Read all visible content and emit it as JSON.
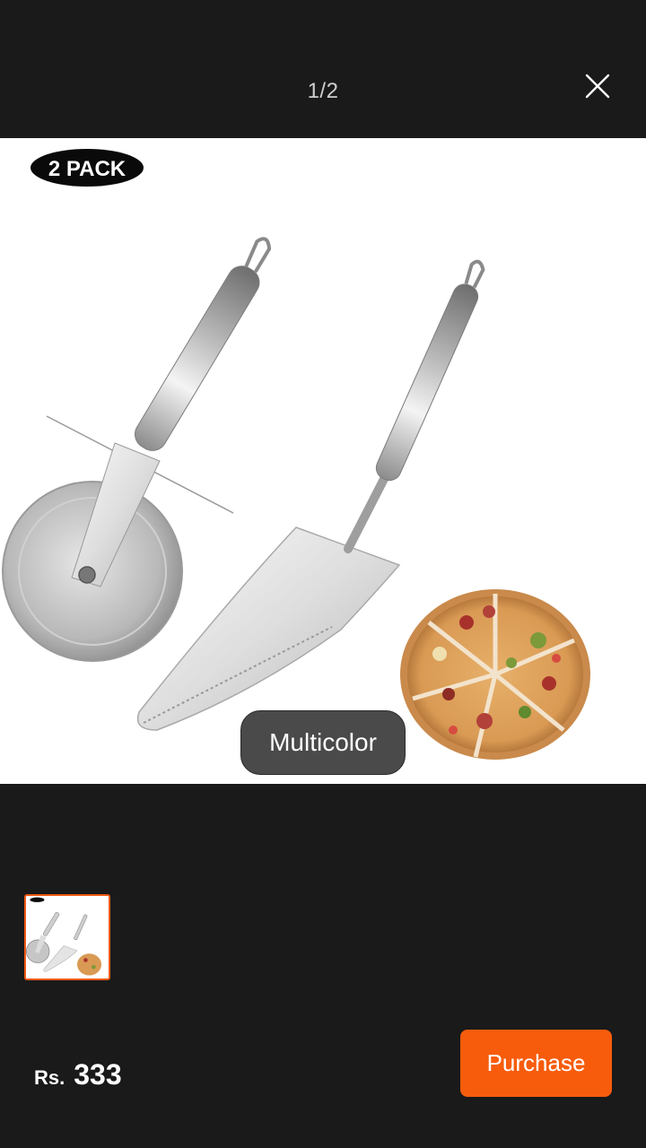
{
  "viewer": {
    "counter": "1/2",
    "badge_text": "2 PACK",
    "variant_label": "Multicolor"
  },
  "footer": {
    "currency": "Rs.",
    "price": "333",
    "purchase_label": "Purchase"
  },
  "colors": {
    "background": "#1a1a1a",
    "accent": "#f75c0c",
    "thumb_border": "#f05a14"
  },
  "icons": {
    "close": "close-icon"
  }
}
